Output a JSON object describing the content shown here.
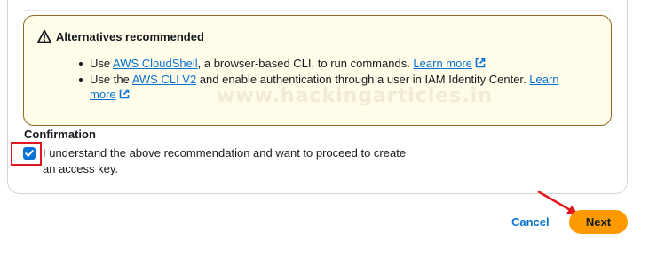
{
  "alert": {
    "title": "Alternatives recommended",
    "item1": {
      "prefix": "Use ",
      "link": "AWS CloudShell",
      "middle": ", a browser-based CLI, to run commands. ",
      "learn_more": "Learn more"
    },
    "item2": {
      "prefix": "Use the ",
      "link": "AWS CLI V2",
      "middle": " and enable authentication through a user in IAM Identity Center. ",
      "learn_more": "Learn more"
    },
    "icon": "warning-icon",
    "colors": {
      "background": "#fffce9",
      "border": "#8e6b1c"
    }
  },
  "watermark": "www.hackingarticles.in",
  "confirmation": {
    "title": "Confirmation",
    "checkbox_label": "I understand the above recommendation and want to proceed to create an access key.",
    "checked": true
  },
  "footer": {
    "cancel_label": "Cancel",
    "next_label": "Next"
  },
  "colors": {
    "link": "#0972d3",
    "primary_button": "#ff9900",
    "annotation": "#e0181d"
  }
}
